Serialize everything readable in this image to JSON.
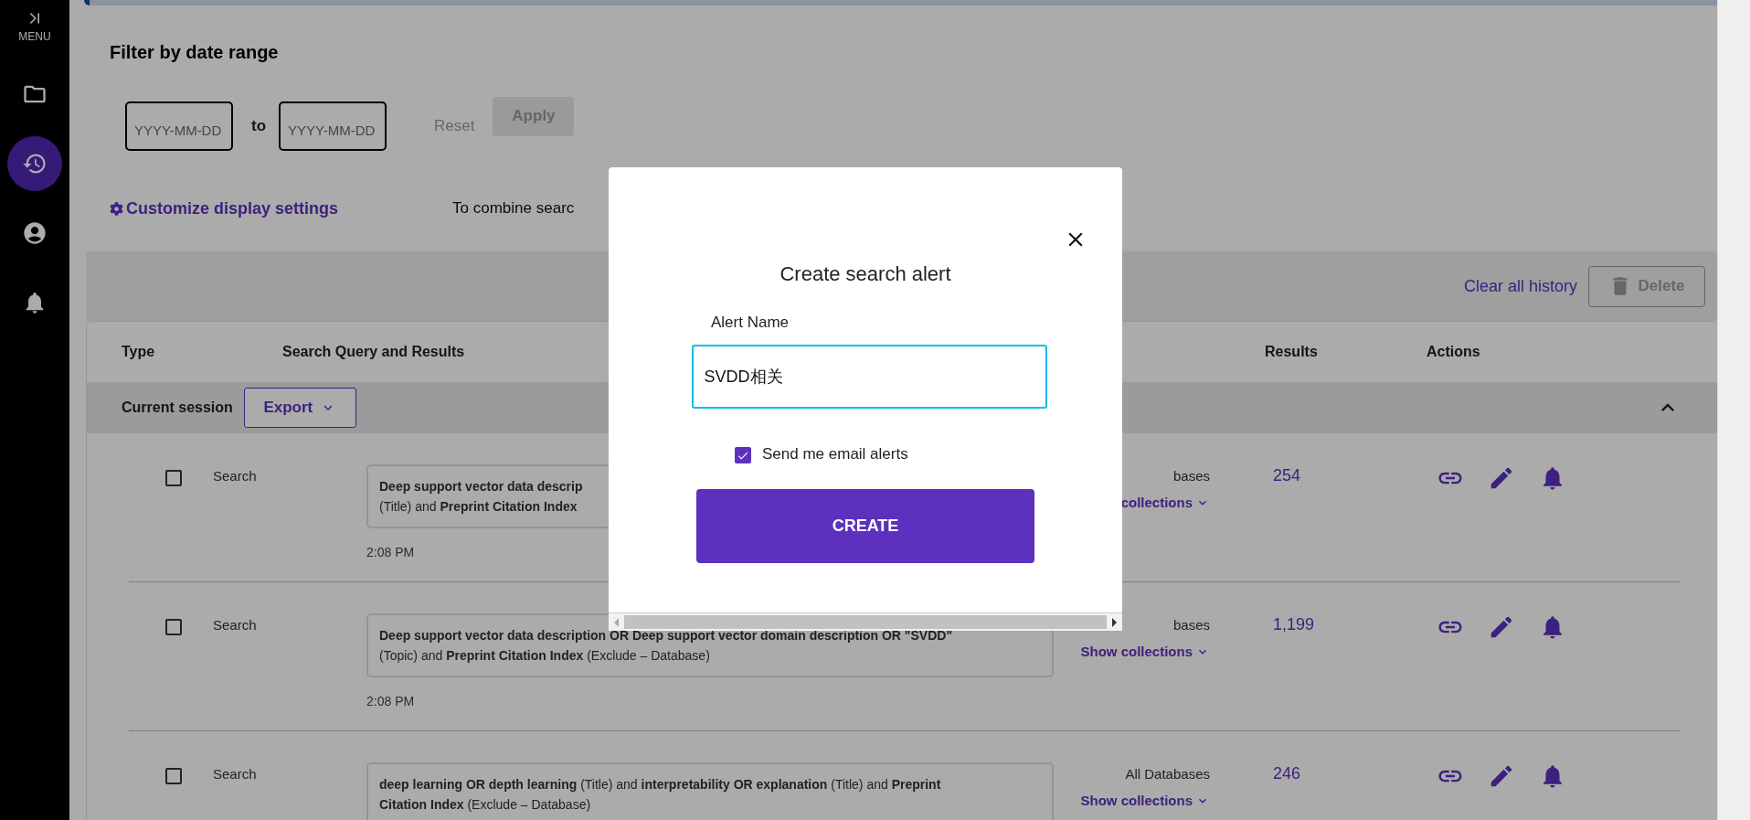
{
  "sidebar": {
    "menu_label": "MENU",
    "items": [
      {
        "kind": "folder",
        "selected": false
      },
      {
        "kind": "history",
        "selected": true
      },
      {
        "kind": "account",
        "selected": false
      },
      {
        "kind": "alerts",
        "selected": false
      }
    ]
  },
  "filter": {
    "title": "Filter by date range",
    "from_placeholder": "YYYY-MM-DD",
    "separator": "to",
    "to_placeholder": "YYYY-MM-DD",
    "reset": {
      "label": "Reset",
      "disabled": true
    },
    "apply": {
      "label": "Apply",
      "disabled": true
    }
  },
  "settings_link": "Customize display settings",
  "combine_hint": "To combine searc",
  "toolbar": {
    "clear": "Clear all history",
    "delete": {
      "label": "Delete",
      "disabled": true
    }
  },
  "table": {
    "columns": [
      "Type",
      "Search Query and Results",
      "Results",
      "Actions"
    ],
    "session": {
      "label": "Current session",
      "export": "Export",
      "expanded": true
    },
    "rows": [
      {
        "checked": false,
        "type": "Search",
        "query_lines": [
          "**Deep support vector data descrip**",
          "(Title) and **Preprint Citation Index**"
        ],
        "time": "2:08 PM",
        "database": "bases",
        "collections": "collections",
        "results": "254"
      },
      {
        "checked": false,
        "type": "Search",
        "query_lines": [
          "**Deep support vector data description OR Deep support vector domain description OR \"SVDD\"**",
          "(Topic) and **Preprint Citation Index** (Exclude – Database)"
        ],
        "time": "2:08 PM",
        "database": "bases",
        "collections": "Show collections",
        "results": "1,199"
      },
      {
        "checked": false,
        "type": "Search",
        "query_lines": [
          "**deep learning OR depth learning** (Title) and **interpretability OR explanation** (Title) and **Preprint**",
          "**Citation Index** (Exclude – Database)"
        ],
        "database": "All Databases",
        "collections": "Show collections",
        "results": "246"
      }
    ]
  },
  "modal": {
    "title": "Create search alert",
    "field_label": "Alert Name",
    "value": "SVDD相关",
    "email_alerts": {
      "label": "Send me email alerts",
      "checked": true
    },
    "button": "CREATE"
  }
}
